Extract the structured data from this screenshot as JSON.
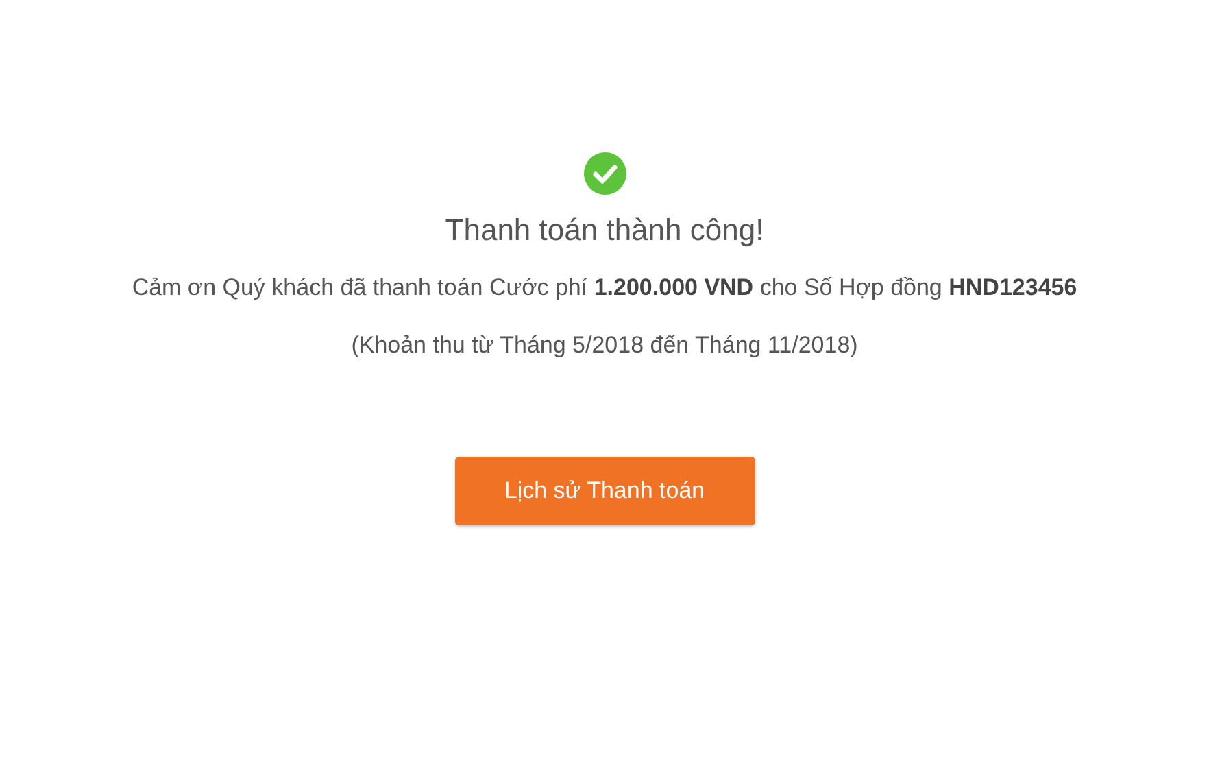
{
  "title": "Thanh toán thành công!",
  "message": "Cảm ơn Quý khách đã thanh toán Cước phí **1.200.000 VND** cho Số Hợp đồng **HND123456**",
  "period": "(Khoản thu từ Tháng 5/2018 đến Tháng 11/2018)",
  "button": "Lịch sử Thanh toán"
}
